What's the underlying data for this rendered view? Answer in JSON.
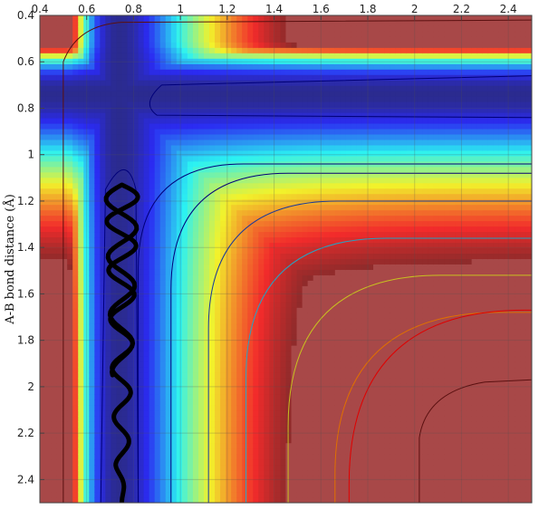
{
  "chart_data": {
    "type": "heatmap",
    "title": "",
    "xlabel": "",
    "ylabel": "A-B bond distance (Å)",
    "x_axis_position": "top",
    "xlim": [
      0.4,
      2.5
    ],
    "ylim": [
      0.4,
      2.5
    ],
    "y_reversed": true,
    "xticks": [
      0.4,
      0.6,
      0.8,
      1,
      1.2,
      1.4,
      1.6,
      1.8,
      2,
      2.2,
      2.4
    ],
    "xtick_labels": [
      "0.4",
      "0.6",
      "0.8",
      "1",
      "1.2",
      "1.4",
      "1.6",
      "1.8",
      "2",
      "2.2",
      "2.4"
    ],
    "yticks": [
      0.4,
      0.6,
      0.8,
      1,
      1.2,
      1.4,
      1.6,
      1.8,
      2,
      2.2,
      2.4
    ],
    "ytick_labels": [
      "0.4",
      "0.6",
      "0.8",
      "1",
      "1.2",
      "1.4",
      "1.6",
      "1.8",
      "2",
      "2.2",
      "2.4"
    ],
    "grid": true,
    "colormap": "jet",
    "surface": "potential energy surface (L-shaped valley)",
    "trajectory": {
      "color": "#000000",
      "start": [
        0.72,
        2.5
      ],
      "end": [
        0.79,
        1.13
      ],
      "oscillation_x_range": [
        0.68,
        0.82
      ]
    },
    "colors": {
      "high": "#a84848",
      "low": "#3a3aa8",
      "contour_blue": "#00007a",
      "contour_red": "#e00000"
    }
  }
}
